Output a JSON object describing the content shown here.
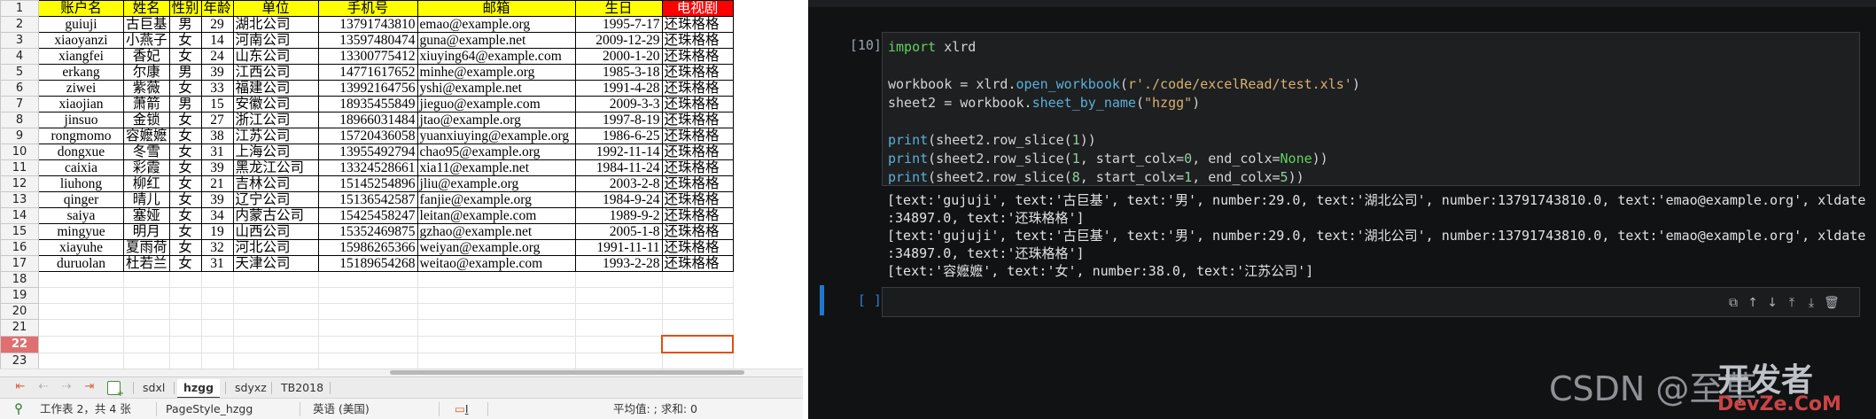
{
  "spreadsheet": {
    "header_row": [
      "账户名",
      "姓名",
      "性别",
      "年龄",
      "单位",
      "手机号",
      "邮箱",
      "生日",
      "电视剧"
    ],
    "rows": [
      [
        "guiuji",
        "古巨基",
        "男",
        "29",
        "湖北公司",
        "13791743810",
        "emao@example.org",
        "1995-7-17",
        "还珠格格"
      ],
      [
        "xiaoyanzi",
        "小燕子",
        "女",
        "14",
        "河南公司",
        "13597480474",
        "guna@example.net",
        "2009-12-29",
        "还珠格格"
      ],
      [
        "xiangfei",
        "香妃",
        "女",
        "24",
        "山东公司",
        "13300775412",
        "xiuying64@example.com",
        "2000-1-20",
        "还珠格格"
      ],
      [
        "erkang",
        "尔康",
        "男",
        "39",
        "江西公司",
        "14771617652",
        "minhe@example.org",
        "1985-3-18",
        "还珠格格"
      ],
      [
        "ziwei",
        "紫薇",
        "女",
        "33",
        "福建公司",
        "13992164756",
        "yshi@example.net",
        "1991-4-28",
        "还珠格格"
      ],
      [
        "xiaojian",
        "萧箭",
        "男",
        "15",
        "安徽公司",
        "18935455849",
        "jieguo@example.com",
        "2009-3-3",
        "还珠格格"
      ],
      [
        "jinsuo",
        "金锁",
        "女",
        "27",
        "浙江公司",
        "18966031484",
        "jtao@example.org",
        "1997-8-19",
        "还珠格格"
      ],
      [
        "rongmomo",
        "容嬷嬷",
        "女",
        "38",
        "江苏公司",
        "15720436058",
        "yuanxiuying@example.org",
        "1986-6-25",
        "还珠格格"
      ],
      [
        "dongxue",
        "冬雪",
        "女",
        "31",
        "上海公司",
        "13955492794",
        "chao95@example.org",
        "1992-11-14",
        "还珠格格"
      ],
      [
        "caixia",
        "彩霞",
        "女",
        "39",
        "黑龙江公司",
        "13324528661",
        "xia11@example.net",
        "1984-11-24",
        "还珠格格"
      ],
      [
        "liuhong",
        "柳红",
        "女",
        "21",
        "吉林公司",
        "15145254896",
        "jliu@example.org",
        "2003-2-8",
        "还珠格格"
      ],
      [
        "qinger",
        "晴儿",
        "女",
        "39",
        "辽宁公司",
        "15136542587",
        "fanjie@example.org",
        "1984-9-24",
        "还珠格格"
      ],
      [
        "saiya",
        "塞娅",
        "女",
        "34",
        "内蒙古公司",
        "15425458247",
        "leitan@example.com",
        "1989-9-2",
        "还珠格格"
      ],
      [
        "mingyue",
        "明月",
        "女",
        "19",
        "山西公司",
        "15352469875",
        "gzhao@example.net",
        "2005-1-8",
        "还珠格格"
      ],
      [
        "xiayuhe",
        "夏雨荷",
        "女",
        "32",
        "河北公司",
        "15986265366",
        "weiyan@example.org",
        "1991-11-11",
        "还珠格格"
      ],
      [
        "duruolan",
        "杜若兰",
        "女",
        "31",
        "天津公司",
        "15189654268",
        "weitao@example.com",
        "1993-2-28",
        "还珠格格"
      ]
    ],
    "row_numbers": [
      "1",
      "2",
      "3",
      "4",
      "5",
      "6",
      "7",
      "8",
      "9",
      "10",
      "11",
      "12",
      "13",
      "14",
      "15",
      "16",
      "17",
      "18",
      "19",
      "20",
      "21",
      "22",
      "23"
    ],
    "active_row": "22",
    "tabs": [
      "sdxl",
      "hzgg",
      "sdyxz",
      "TB2018"
    ],
    "active_tab": "hzgg",
    "status": {
      "sheet_info": "工作表 2，共 4 张",
      "page_style": "PageStyle_hzgg",
      "language": "英语 (美国)",
      "sum_info": "平均值: ; 求和: 0"
    }
  },
  "notebook": {
    "cell_prompt": "[10]:",
    "code_lines": [
      [
        {
          "t": "kw",
          "v": "import"
        },
        {
          "t": "nm",
          "v": " xlrd"
        }
      ],
      [],
      [
        {
          "t": "nm",
          "v": "workbook = xlrd."
        },
        {
          "t": "fn",
          "v": "open_workbook"
        },
        {
          "t": "nm",
          "v": "("
        },
        {
          "t": "str",
          "v": "r'./code/excelRead/test.xls'"
        },
        {
          "t": "nm",
          "v": ")"
        }
      ],
      [
        {
          "t": "nm",
          "v": "sheet2 = workbook."
        },
        {
          "t": "fn",
          "v": "sheet_by_name"
        },
        {
          "t": "nm",
          "v": "("
        },
        {
          "t": "str",
          "v": "\"hzgg\""
        },
        {
          "t": "nm",
          "v": ")"
        }
      ],
      [],
      [
        {
          "t": "fn",
          "v": "print"
        },
        {
          "t": "nm",
          "v": "(sheet2.row_slice("
        },
        {
          "t": "num",
          "v": "1"
        },
        {
          "t": "nm",
          "v": "))"
        }
      ],
      [
        {
          "t": "fn",
          "v": "print"
        },
        {
          "t": "nm",
          "v": "(sheet2.row_slice("
        },
        {
          "t": "num",
          "v": "1"
        },
        {
          "t": "nm",
          "v": ", start_colx="
        },
        {
          "t": "num",
          "v": "0"
        },
        {
          "t": "nm",
          "v": ", end_colx="
        },
        {
          "t": "kw",
          "v": "None"
        },
        {
          "t": "nm",
          "v": "))"
        }
      ],
      [
        {
          "t": "fn",
          "v": "print"
        },
        {
          "t": "nm",
          "v": "(sheet2.row_slice("
        },
        {
          "t": "num",
          "v": "8"
        },
        {
          "t": "nm",
          "v": ", start_colx="
        },
        {
          "t": "num",
          "v": "1"
        },
        {
          "t": "nm",
          "v": ", end_colx="
        },
        {
          "t": "num",
          "v": "5"
        },
        {
          "t": "nm",
          "v": "))"
        }
      ]
    ],
    "output_lines": [
      "[text:'gujuji', text:'古巨基', text:'男', number:29.0, text:'湖北公司', number:13791743810.0, text:'emao@example.org', xldate",
      ":34897.0, text:'还珠格格']",
      "[text:'gujuji', text:'古巨基', text:'男', number:29.0, text:'湖北公司', number:13791743810.0, text:'emao@example.org', xldate",
      ":34897.0, text:'还珠格格']",
      "[text:'容嬷嬷', text:'女', number:38.0, text:'江苏公司']"
    ],
    "empty_prompt": "[ ]:",
    "cell_tools": [
      {
        "name": "copy-icon",
        "glyph": "⧉"
      },
      {
        "name": "move-up-icon",
        "glyph": "↑"
      },
      {
        "name": "move-down-icon",
        "glyph": "↓"
      },
      {
        "name": "insert-above-icon",
        "glyph": "⤒"
      },
      {
        "name": "insert-below-icon",
        "glyph": "⤓"
      },
      {
        "name": "delete-icon",
        "glyph": "🗑"
      }
    ]
  },
  "watermark": {
    "text": "CSDN @至草",
    "logo_top": "开发者",
    "logo_bottom": "DevZe.CoM"
  }
}
